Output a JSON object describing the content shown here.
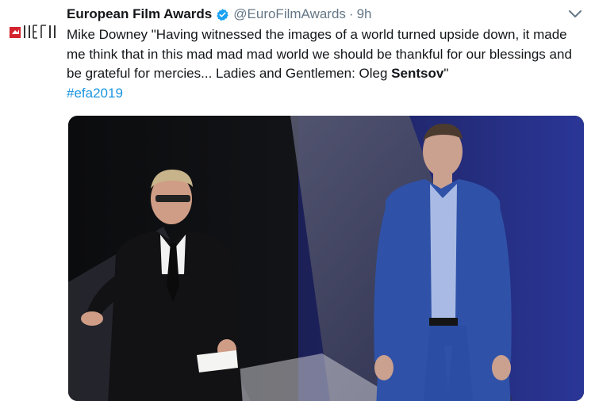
{
  "tweet": {
    "display_name": "European Film Awards",
    "handle": "@EuroFilmAwards",
    "separator": "·",
    "time": "9h",
    "text_before_bold": "Mike Downey \"Having witnessed the images of a world turned upside down, it made me think that in this mad mad mad world we should be thankful for our blessings and be grateful for mercies... Ladies and Gentlemen: Oleg ",
    "text_bold": "Sentsov",
    "text_after_bold": "\"",
    "hashtag": "#efa2019"
  },
  "colors": {
    "text": "#14171a",
    "secondary": "#657786",
    "link": "#1b95e0",
    "verified": "#1da1f2",
    "logo_red": "#d3232f"
  },
  "icons": {
    "avatar": "efa-logo-icon",
    "verified": "verified-badge-icon",
    "caret": "chevron-down-icon"
  }
}
